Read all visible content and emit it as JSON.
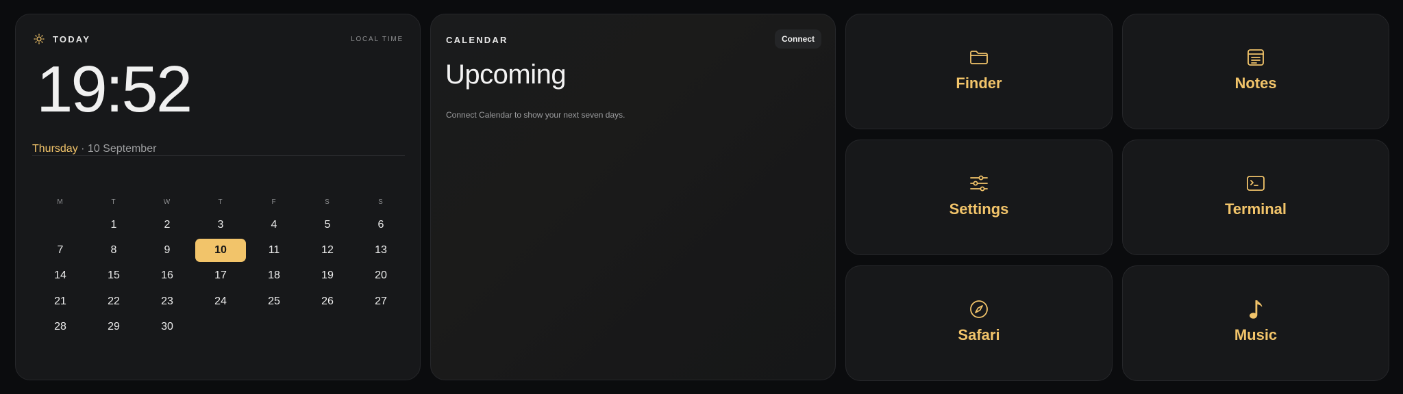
{
  "today": {
    "label": "TODAY",
    "local_time_label": "LOCAL TIME",
    "time": "19:52",
    "weekday": "Thursday",
    "separator": " · ",
    "date": "10 September",
    "weekday_headers": [
      "M",
      "T",
      "W",
      "T",
      "F",
      "S",
      "S"
    ],
    "days": [
      "",
      "1",
      "2",
      "3",
      "4",
      "5",
      "6",
      "7",
      "8",
      "9",
      "10",
      "11",
      "12",
      "13",
      "14",
      "15",
      "16",
      "17",
      "18",
      "19",
      "20",
      "21",
      "22",
      "23",
      "24",
      "25",
      "26",
      "27",
      "28",
      "29",
      "30"
    ],
    "selected_day": "10"
  },
  "calendar": {
    "label": "CALENDAR",
    "connect_label": "Connect",
    "heading": "Upcoming",
    "message": "Connect Calendar to show your next seven days."
  },
  "apps": [
    {
      "name": "Finder",
      "icon": "folder-icon"
    },
    {
      "name": "Notes",
      "icon": "notes-icon"
    },
    {
      "name": "Settings",
      "icon": "sliders-icon"
    },
    {
      "name": "Terminal",
      "icon": "terminal-icon"
    },
    {
      "name": "Safari",
      "icon": "compass-icon"
    },
    {
      "name": "Music",
      "icon": "music-note-icon"
    }
  ],
  "colors": {
    "accent": "#f2c46a",
    "background": "#0b0c0e",
    "panel": "#17181a"
  }
}
